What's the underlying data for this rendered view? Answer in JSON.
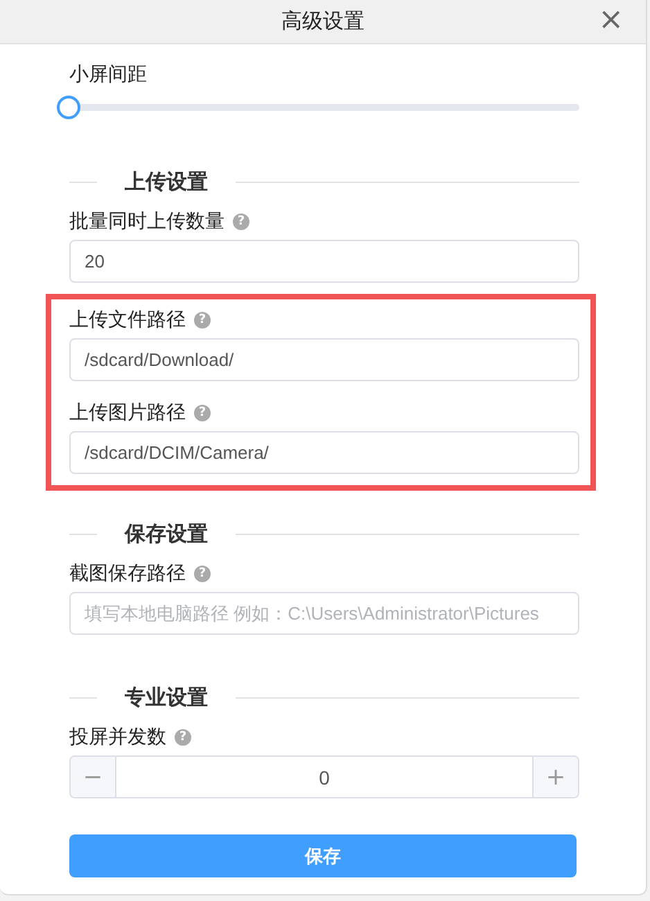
{
  "window": {
    "title": "高级设置",
    "close": "×"
  },
  "slider": {
    "label": "小屏间距",
    "level": 0
  },
  "sections": [
    {
      "title": "上传设置",
      "fields": [
        {
          "kind": "text",
          "label": "批量同时上传数量",
          "help": "?",
          "value": "20",
          "highlighted": false
        },
        {
          "kind": "text",
          "label": "上传文件路径",
          "help": "?",
          "value": "/sdcard/Download/",
          "highlighted": true
        },
        {
          "kind": "text",
          "label": "上传图片路径",
          "help": "?",
          "value": "/sdcard/DCIM/Camera/",
          "highlighted": true
        }
      ]
    },
    {
      "title": "保存设置",
      "fields": [
        {
          "kind": "text",
          "label": "截图保存路径",
          "help": "?",
          "placeholder": "填写本地电脑路径 例如：C:\\Users\\Administrator\\Pictures",
          "highlighted": false
        }
      ]
    },
    {
      "title": "专业设置",
      "fields": [
        {
          "kind": "stepper",
          "label": "投屏并发数",
          "help": "?",
          "value": "0",
          "minus": "−",
          "plus": "+",
          "highlighted": false
        }
      ]
    }
  ],
  "save_button": "保存"
}
